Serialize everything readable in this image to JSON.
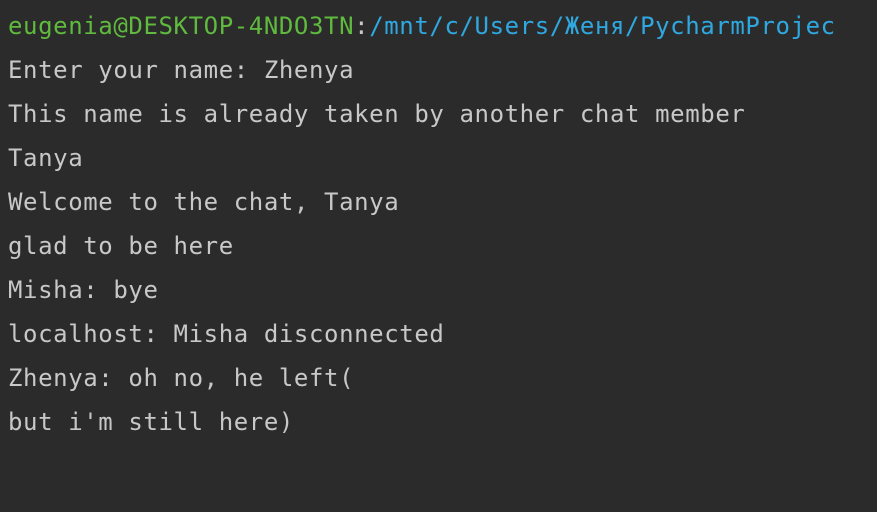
{
  "prompt": {
    "user_host": "eugenia@DESKTOP-4NDO3TN",
    "separator": ":",
    "path": "/mnt/c/Users/Женя/PycharmProjec"
  },
  "lines": [
    "Enter your name: Zhenya",
    "This name is already taken by another chat member",
    "Tanya",
    "Welcome to the chat, Tanya",
    "glad to be here",
    "Misha: bye",
    "localhost: Misha disconnected",
    "Zhenya: oh no, he left(",
    "but i'm still here)"
  ],
  "colors": {
    "background": "#2b2b2b",
    "text": "#c8c8c8",
    "user_host": "#5fba3e",
    "path": "#2fa8e0"
  }
}
